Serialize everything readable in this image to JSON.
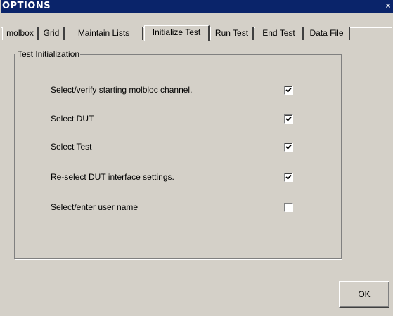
{
  "window": {
    "title": "OPTIONS",
    "close_glyph": "×"
  },
  "tabs": [
    {
      "label": "molbox",
      "active": false
    },
    {
      "label": "Grid",
      "active": false
    },
    {
      "label": "Maintain Lists",
      "active": false
    },
    {
      "label": "Initialize Test",
      "active": true
    },
    {
      "label": "Run Test",
      "active": false
    },
    {
      "label": "End Test",
      "active": false
    },
    {
      "label": "Data File",
      "active": false
    }
  ],
  "group": {
    "title": "Test Initialization",
    "options": [
      {
        "label": "Select/verify starting molbloc channel.",
        "checked": true
      },
      {
        "label": "Select DUT",
        "checked": true
      },
      {
        "label": "Select Test",
        "checked": true
      },
      {
        "label": "Re-select DUT interface settings.",
        "checked": true
      },
      {
        "label": "Select/enter user name",
        "checked": false
      }
    ]
  },
  "ok_button": {
    "mnemonic": "O",
    "rest": "K"
  },
  "icons": {
    "close": "close-icon",
    "check": "checkmark-icon"
  }
}
